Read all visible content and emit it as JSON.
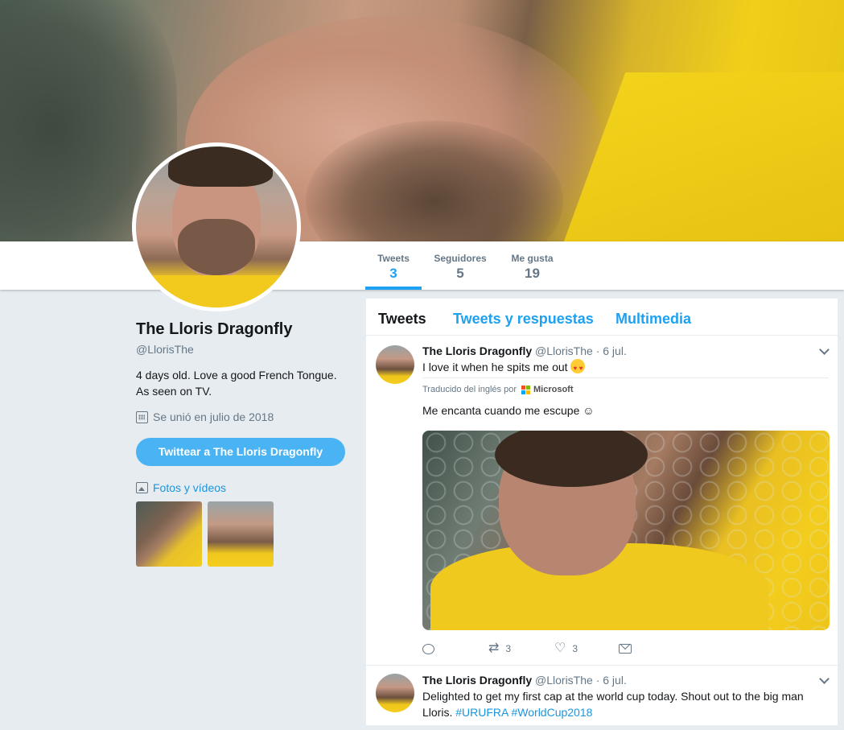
{
  "nav": {
    "stats": [
      {
        "label": "Tweets",
        "value": "3"
      },
      {
        "label": "Seguidores",
        "value": "5"
      },
      {
        "label": "Me gusta",
        "value": "19"
      }
    ]
  },
  "profile": {
    "name": "The Lloris Dragonfly",
    "handle": "@LlorisThe",
    "bio_line1": "4 days old. Love a good French Tongue.",
    "bio_line2": "As seen on TV.",
    "joined": "Se unió en julio de 2018",
    "tweet_to_button": "Twittear a The Lloris Dragonfly",
    "photos_link": "Fotos y vídeos"
  },
  "timeline": {
    "tabs": [
      "Tweets",
      "Tweets y respuestas",
      "Multimedia"
    ],
    "tweets": [
      {
        "name": "The Lloris Dragonfly",
        "handle": "@LlorisThe",
        "date": "· 6 jul.",
        "text": "I love it when he spits me out",
        "translated_label": "Traducido del inglés por",
        "translator": "Microsoft",
        "translation": "Me encanta cuando me escupe ☺",
        "retweets": "3",
        "likes": "3"
      },
      {
        "name": "The Lloris Dragonfly",
        "handle": "@LlorisThe",
        "date": "· 6 jul.",
        "text_line1": "Delighted to get my first cap at the world cup today. Shout out to the big man",
        "text_line2_prefix": "Lloris.",
        "hashtag1": "#URUFRA",
        "hashtag2": "#WorldCup2018"
      }
    ]
  },
  "colors": {
    "accent": "#1da1f2",
    "background": "#e6ecf0",
    "ms_red": "#f25022",
    "ms_green": "#7fba00",
    "ms_blue": "#00a4ef",
    "ms_yellow": "#ffb900"
  }
}
